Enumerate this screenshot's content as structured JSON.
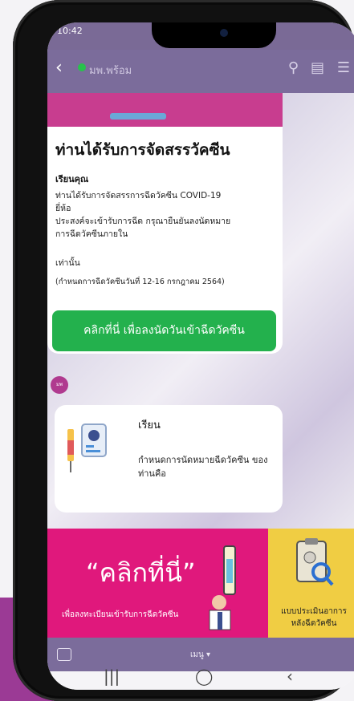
{
  "status": {
    "time": "10:42"
  },
  "header": {
    "title": "มพ.พร้อม"
  },
  "card": {
    "title": "ท่านได้รับการจัดสรรวัคซีน",
    "dear": "เรียนคุณ",
    "line1": "ท่านได้รับการจัดสรรการฉีดวัคซีน COVID-19",
    "line2": "ยี่ห้อ",
    "line3": "ประสงค์จะเข้ารับการฉีด กรุณายืนยันลงนัดหมาย",
    "line4": "การฉีดวัคซีนภายใน",
    "line5": "เท่านั้น",
    "note": "(กำหนดการฉีดวัคซีนวันที่ 12-16 กรกฎาคม 2564)",
    "button": "คลิกที่นี่ เพื่อลงนัดวันเข้าฉีดวัคซีน"
  },
  "card2": {
    "title": "เรียน",
    "body": "กำหนดการนัดหมายฉีดวัคซีน ของท่านคือ"
  },
  "rich_menu": {
    "big": "“คลิกที่นี่”",
    "sub": "เพื่อลงทะเบียนเข้ารับการฉีดวัคซีน",
    "right_label": "แบบประเมินอาการ หลังฉีดวัคซีน"
  },
  "menu_bar": {
    "label": "เมนู ▾"
  }
}
